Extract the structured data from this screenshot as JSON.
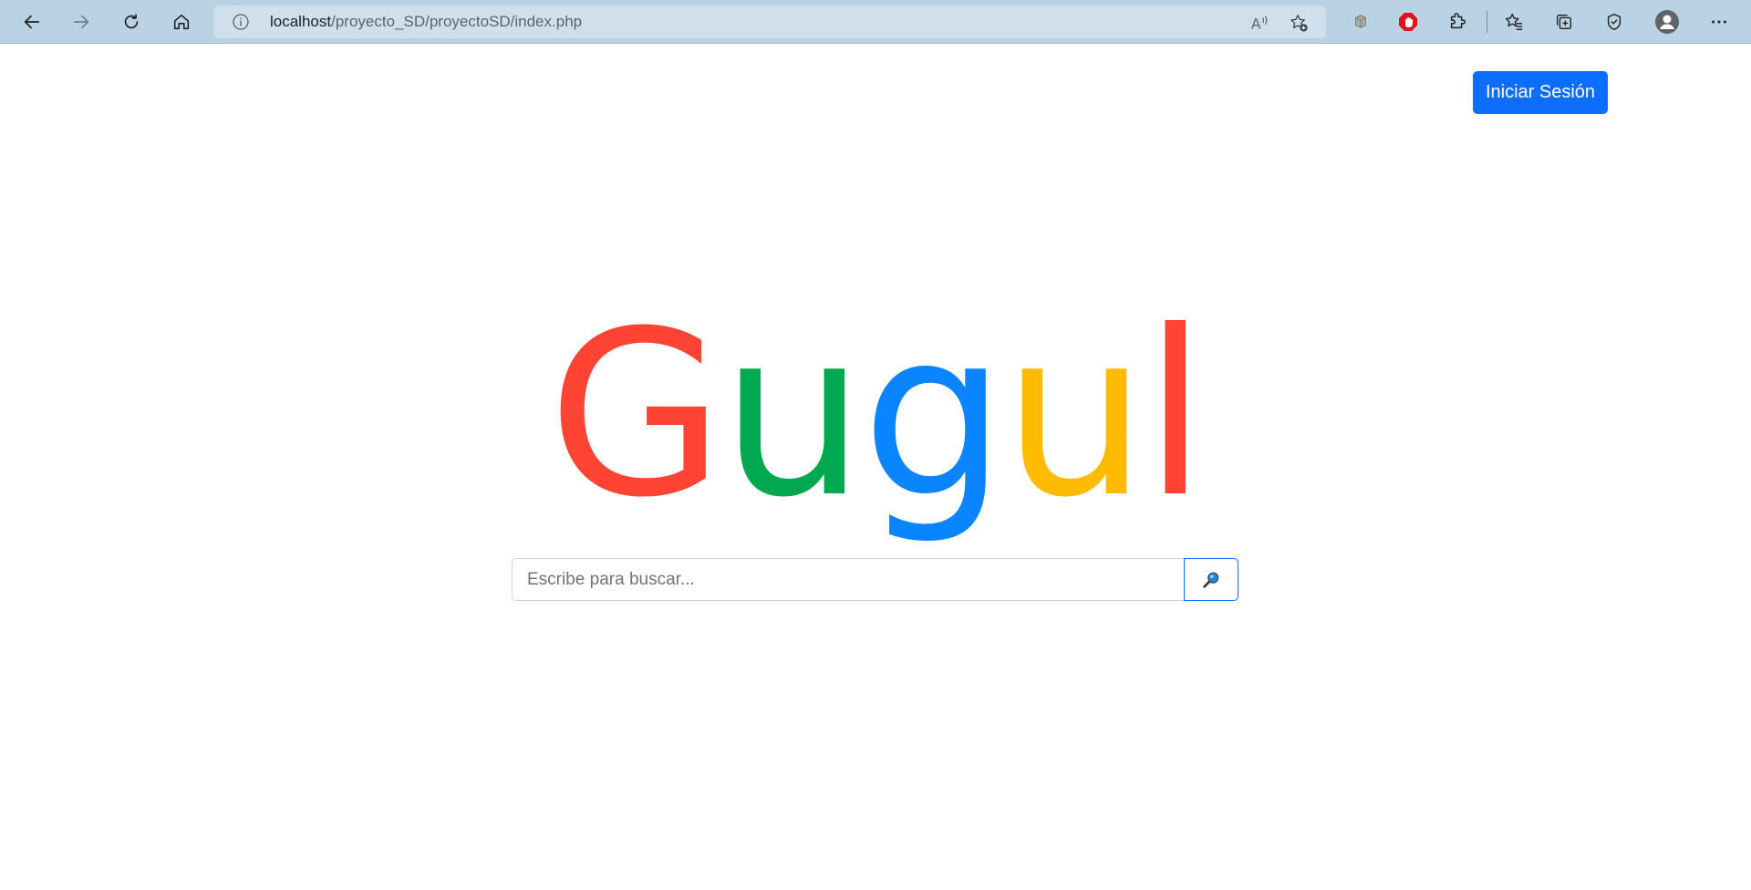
{
  "browser": {
    "url_host": "localhost",
    "url_path": "/proyecto_SD/proyectoSD/index.php",
    "icons": [
      "back-icon",
      "forward-icon",
      "refresh-icon",
      "home-icon",
      "info-icon",
      "read-aloud-icon",
      "add-favorite-icon",
      "extension-cube-icon",
      "adblock-icon",
      "extensions-icon",
      "favorites-icon",
      "collections-icon",
      "performance-icon",
      "profile-icon",
      "more-icon"
    ]
  },
  "header": {
    "login_label": "Iniciar Sesión"
  },
  "logo": {
    "letters": [
      "G",
      "u",
      "g",
      "u",
      "l"
    ],
    "colors": [
      "#ff4433",
      "#00a94f",
      "#0a84ff",
      "#ffbb00",
      "#ff4433"
    ]
  },
  "search": {
    "placeholder": "Escribe para buscar...",
    "value": "",
    "button_icon": "search-icon"
  }
}
